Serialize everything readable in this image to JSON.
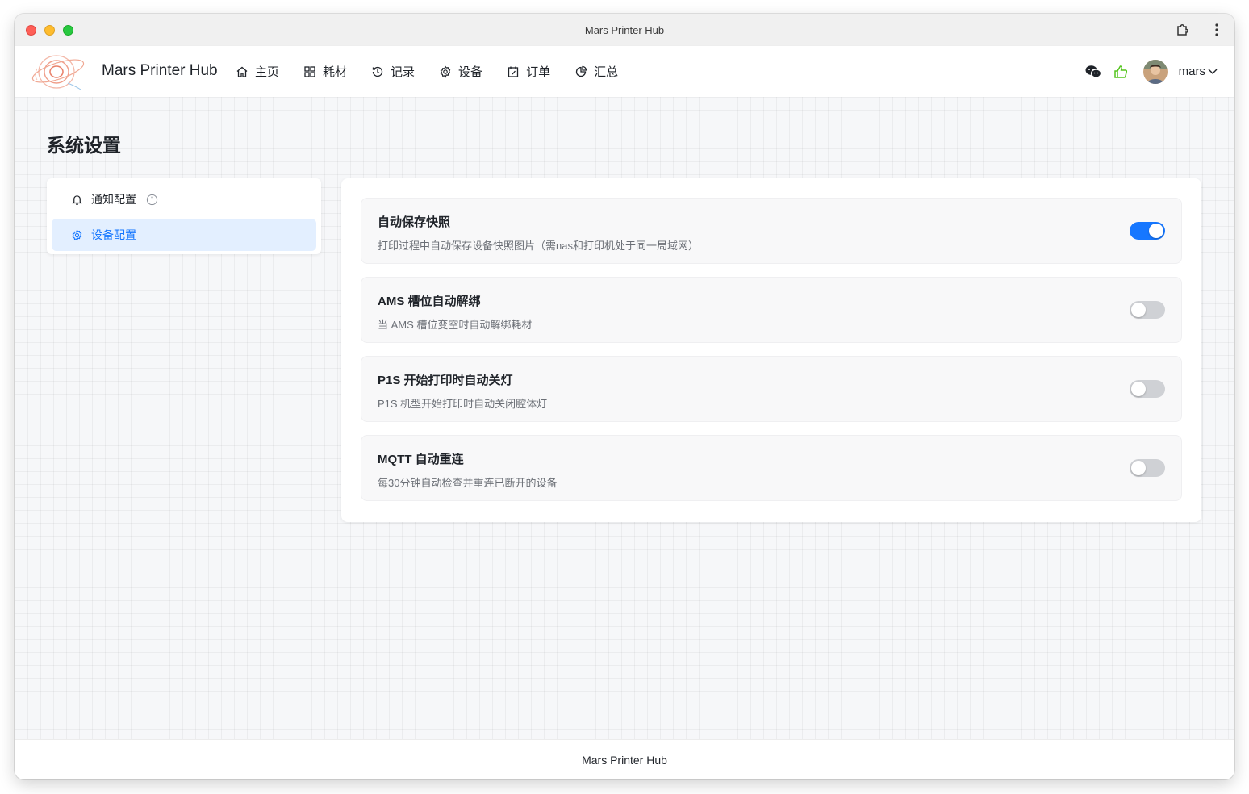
{
  "window": {
    "title": "Mars Printer Hub"
  },
  "header": {
    "brand": "Mars Printer Hub",
    "nav": [
      {
        "label": "主页",
        "icon": "home-icon"
      },
      {
        "label": "耗材",
        "icon": "grid-icon"
      },
      {
        "label": "记录",
        "icon": "history-icon"
      },
      {
        "label": "设备",
        "icon": "gear-icon"
      },
      {
        "label": "订单",
        "icon": "calendar-icon"
      },
      {
        "label": "汇总",
        "icon": "pie-chart-icon"
      }
    ],
    "user": {
      "name": "mars"
    },
    "colors": {
      "like_icon": "#52c41a"
    }
  },
  "page": {
    "title": "系统设置"
  },
  "sidebar": {
    "items": [
      {
        "label": "通知配置",
        "icon": "bell-icon",
        "active": false
      },
      {
        "label": "设备配置",
        "icon": "gear-icon",
        "active": true
      }
    ]
  },
  "settings": [
    {
      "title": "自动保存快照",
      "desc": "打印过程中自动保存设备快照图片（需nas和打印机处于同一局域网）",
      "enabled": true
    },
    {
      "title": "AMS 槽位自动解绑",
      "desc": "当 AMS 槽位变空时自动解绑耗材",
      "enabled": false
    },
    {
      "title": "P1S 开始打印时自动关灯",
      "desc": "P1S 机型开始打印时自动关闭腔体灯",
      "enabled": false
    },
    {
      "title": "MQTT 自动重连",
      "desc": "每30分钟自动检查并重连已断开的设备",
      "enabled": false
    }
  ],
  "footer": {
    "text": "Mars Printer Hub"
  },
  "colors": {
    "accent": "#1677ff",
    "active_bg": "#e3efff",
    "toggle_off": "#cfd1d5"
  }
}
